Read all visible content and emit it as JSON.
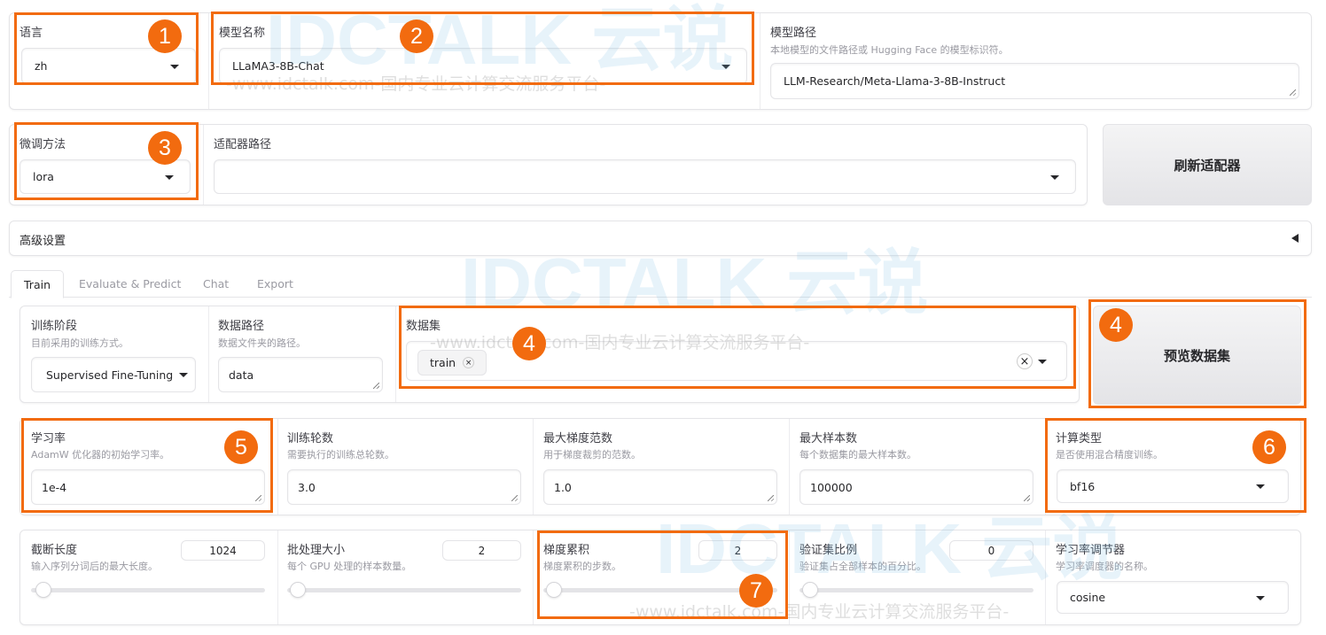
{
  "top": {
    "lang": {
      "label": "语言",
      "value": "zh"
    },
    "model_name": {
      "label": "模型名称",
      "value": "LLaMA3-8B-Chat"
    },
    "model_path": {
      "label": "模型路径",
      "info": "本地模型的文件路径或 Hugging Face 的模型标识符。",
      "value": "LLM-Research/Meta-Llama-3-8B-Instruct"
    }
  },
  "row2": {
    "finetune": {
      "label": "微调方法",
      "value": "lora"
    },
    "adapter": {
      "label": "适配器路径",
      "value": ""
    },
    "refresh_label": "刷新适配器"
  },
  "advanced": {
    "label": "高级设置",
    "icon": "triangle-left-icon"
  },
  "tabs": [
    {
      "label": "Train",
      "active": true
    },
    {
      "label": "Evaluate & Predict"
    },
    {
      "label": "Chat"
    },
    {
      "label": "Export"
    }
  ],
  "train": {
    "stage": {
      "label": "训练阶段",
      "info": "目前采用的训练方式。",
      "value": "Supervised Fine-Tuning"
    },
    "data_dir": {
      "label": "数据路径",
      "info": "数据文件夹的路径。",
      "value": "data"
    },
    "dataset": {
      "label": "数据集",
      "chips": [
        "train"
      ]
    },
    "preview_label": "预览数据集",
    "lr": {
      "label": "学习率",
      "info": "AdamW 优化器的初始学习率。",
      "value": "1e-4"
    },
    "epochs": {
      "label": "训练轮数",
      "info": "需要执行的训练总轮数。",
      "value": "3.0"
    },
    "max_grad": {
      "label": "最大梯度范数",
      "info": "用于梯度裁剪的范数。",
      "value": "1.0"
    },
    "max_samples": {
      "label": "最大样本数",
      "info": "每个数据集的最大样本数。",
      "value": "100000"
    },
    "compute": {
      "label": "计算类型",
      "info": "是否使用混合精度训练。",
      "value": "bf16"
    },
    "cutoff": {
      "label": "截断长度",
      "info": "输入序列分词后的最大长度。",
      "value": "1024",
      "slider": 0.01
    },
    "batch": {
      "label": "批处理大小",
      "info": "每个 GPU 处理的样本数量。",
      "value": "2",
      "slider": 0.0
    },
    "grad_acc": {
      "label": "梯度累积",
      "info": "梯度累积的步数。",
      "value": "2",
      "slider": 0.0
    },
    "val": {
      "label": "验证集比例",
      "info": "验证集占全部样本的百分比。",
      "value": "0",
      "slider": 0.0
    },
    "scheduler": {
      "label": "学习率调节器",
      "info": "学习率调度器的名称。",
      "value": "cosine"
    }
  },
  "annotations": [
    "1",
    "2",
    "3",
    "4",
    "4",
    "5",
    "6",
    "7"
  ],
  "watermark": {
    "logo": "IDCTALK 云说",
    "text": "-www.idctalk.com-国内专业云计算交流服务平台-"
  },
  "colors": {
    "annotation": "#f26b0f"
  }
}
